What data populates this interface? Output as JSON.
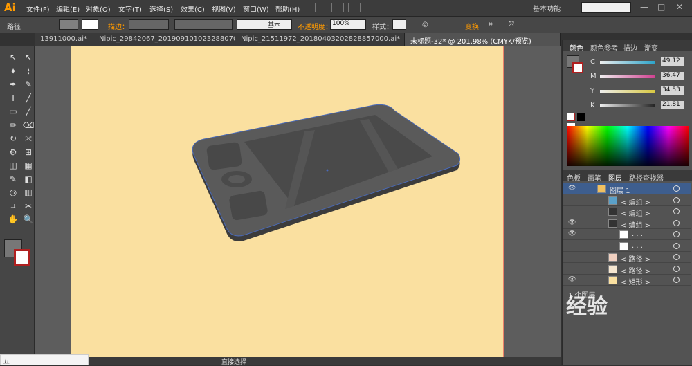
{
  "app": {
    "logo": "Ai",
    "workspace": "基本功能"
  },
  "menus": [
    "文件(F)",
    "编辑(E)",
    "对象(O)",
    "文字(T)",
    "选择(S)",
    "效果(C)",
    "视图(V)",
    "窗口(W)",
    "帮助(H)"
  ],
  "control": {
    "path_label": "路径",
    "stroke_label": "描边：",
    "stroke_style": "基本",
    "opacity_label": "不透明度：",
    "opacity_value": "100%",
    "style_label": "样式：",
    "transform_label": "变换"
  },
  "tabs": [
    "13911000.ai*",
    "Nipic_29842067_20190910102328807000.ai*",
    "Nipic_21511972_20180403202828857000.ai*",
    "未标题-32* @ 201.98% (CMYK/预览)"
  ],
  "color_panel": {
    "tabs": [
      "颜色",
      "颜色参考",
      "描边",
      "渐变"
    ],
    "sliders": [
      {
        "k": "C",
        "v": "49.12",
        "c": "#2ba3c9"
      },
      {
        "k": "M",
        "v": "36.47",
        "c": "#d04090"
      },
      {
        "k": "Y",
        "v": "34.53",
        "c": "#d8c840"
      },
      {
        "k": "K",
        "v": "21.81",
        "c": "#222222"
      }
    ]
  },
  "layers_panel": {
    "tabs": [
      "色板",
      "画笔",
      "图层",
      "路径查找器"
    ],
    "rows": [
      {
        "name": "图层 1",
        "thumb": "#f0c060"
      },
      {
        "name": "< 编组 >",
        "thumb": "#5aa0c8"
      },
      {
        "name": "< 编组 >",
        "thumb": "#333333"
      },
      {
        "name": "< 编组 >",
        "thumb": "#333333"
      },
      {
        "name": ". . .",
        "thumb": "#ffffff"
      },
      {
        "name": ". . .",
        "thumb": "#ffffff"
      },
      {
        "name": "< 路径 >",
        "thumb": "#f0d0c0"
      },
      {
        "name": "< 路径 >",
        "thumb": "#f5e6d0"
      },
      {
        "name": "< 矩形 >",
        "thumb": "#fae0a0"
      }
    ],
    "count": "1 个图层"
  },
  "status": {
    "tool": "直接选择"
  },
  "watermark": "经验",
  "ime": "五"
}
